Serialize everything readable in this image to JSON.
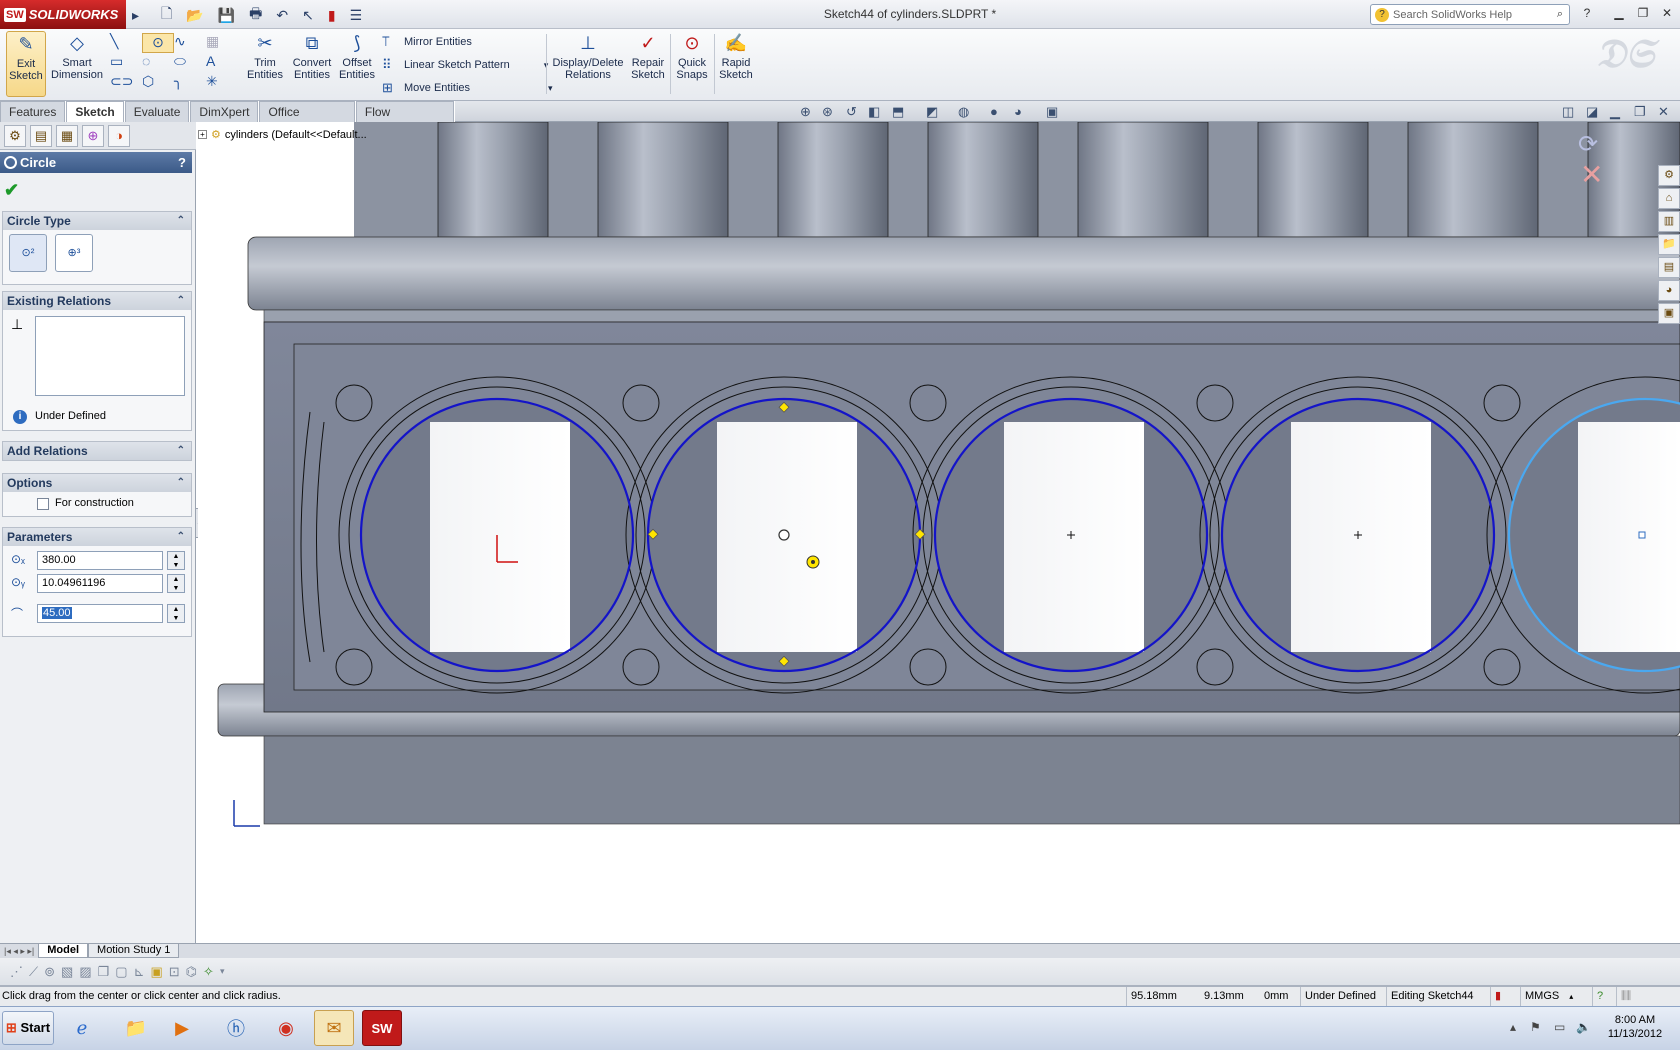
{
  "app": {
    "brand": "SOLIDWORKS",
    "brand_short": "SW",
    "document_title": "Sketch44 of cylinders.SLDPRT *"
  },
  "search": {
    "placeholder": "Search SolidWorks Help"
  },
  "toolbar": {
    "exit_sketch": "Exit Sketch",
    "smart_dimension": "Smart Dimension",
    "trim_entities": "Trim Entities",
    "convert_entities": "Convert Entities",
    "offset_entities": "Offset Entities",
    "mirror_entities": "Mirror Entities",
    "linear_sketch_pattern": "Linear Sketch Pattern",
    "move_entities": "Move Entities",
    "display_delete_relations": "Display/Delete Relations",
    "repair_sketch": "Repair Sketch",
    "quick_snaps": "Quick Snaps",
    "rapid_sketch": "Rapid Sketch"
  },
  "tabs": [
    "Features",
    "Sketch",
    "Evaluate",
    "DimXpert",
    "Office Products",
    "Flow Simulation"
  ],
  "active_tab": "Sketch",
  "tree": {
    "root": "cylinders  (Default<<Default..."
  },
  "property_manager": {
    "title": "Circle",
    "help": "?",
    "circle_type": {
      "header": "Circle Type",
      "btn1": "⊙²",
      "btn2": "⊕³"
    },
    "existing_relations": {
      "header": "Existing Relations",
      "status": "Under Defined"
    },
    "add_relations": {
      "header": "Add Relations"
    },
    "options": {
      "header": "Options",
      "for_construction": "For construction"
    },
    "parameters": {
      "header": "Parameters",
      "x": "380.00",
      "y": "10.04961196",
      "radius": "45.00"
    }
  },
  "bottom_tabs": [
    "Model",
    "Motion Study 1"
  ],
  "status": {
    "hint": "Click drag from the center or click center and click radius.",
    "x": "95.18mm",
    "y": "9.13mm",
    "z": "0mm",
    "state": "Under Defined",
    "editing": "Editing Sketch44",
    "units": "MMGS"
  },
  "taskbar": {
    "start": "Start",
    "time": "8:00 AM",
    "date": "11/13/2012"
  },
  "colors": {
    "accent": "#3b5a88",
    "sketch_blue": "#1414c8",
    "model_gray": "#767d8c",
    "brand_red": "#c01a1a"
  }
}
